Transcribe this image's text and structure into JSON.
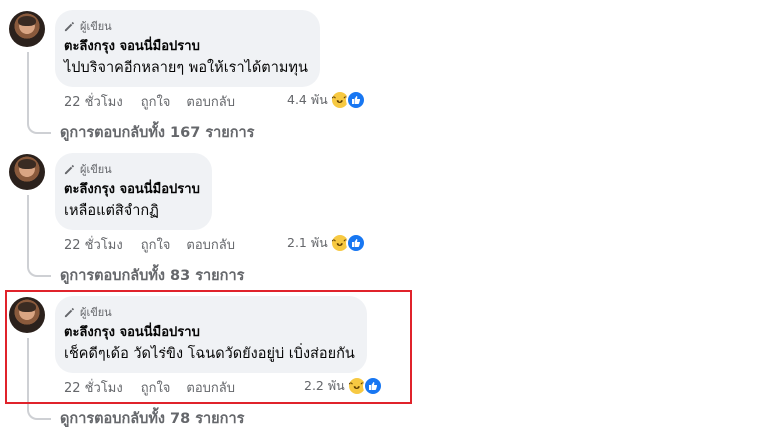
{
  "comments": [
    {
      "author_badge": "ผู้เขียน",
      "author": "ตะลึงกรุง จอนนี่มือปราบ",
      "text": "ไปบริจาคอีกหลายๆ พอให้เราได้ตามทุน",
      "time": "22 ชั่วโมง",
      "like_label": "ถูกใจ",
      "reply_label": "ตอบกลับ",
      "reaction_count": "4.4 พัน",
      "view_replies": "ดูการตอบกลับทั้ง 167 รายการ"
    },
    {
      "author_badge": "ผู้เขียน",
      "author": "ตะลึงกรุง จอนนี่มือปราบ",
      "text": "เหลือแต่สิจำกฏิ",
      "time": "22 ชั่วโมง",
      "like_label": "ถูกใจ",
      "reply_label": "ตอบกลับ",
      "reaction_count": "2.1 พัน",
      "view_replies": "ดูการตอบกลับทั้ง 83 รายการ"
    },
    {
      "author_badge": "ผู้เขียน",
      "author": "ตะลึงกรุง จอนนี่มือปราบ",
      "text": "เช็คดีๆเด้อ วัดไร่ขิง โฉนดวัดยังอยู่บ่ เบิ่งส่อยกัน",
      "time": "22 ชั่วโมง",
      "like_label": "ถูกใจ",
      "reply_label": "ตอบกลับ",
      "reaction_count": "2.2 พัน",
      "view_replies": "ดูการตอบกลับทั้ง 78 รายการ"
    }
  ],
  "icons": {
    "badge": "pencil-icon",
    "reaction_1": "haha-icon",
    "reaction_2": "like-icon"
  },
  "colors": {
    "highlight": "#e0232b",
    "bubble": "#f0f2f5",
    "meta": "#65676b",
    "like_blue": "#1877f2"
  }
}
